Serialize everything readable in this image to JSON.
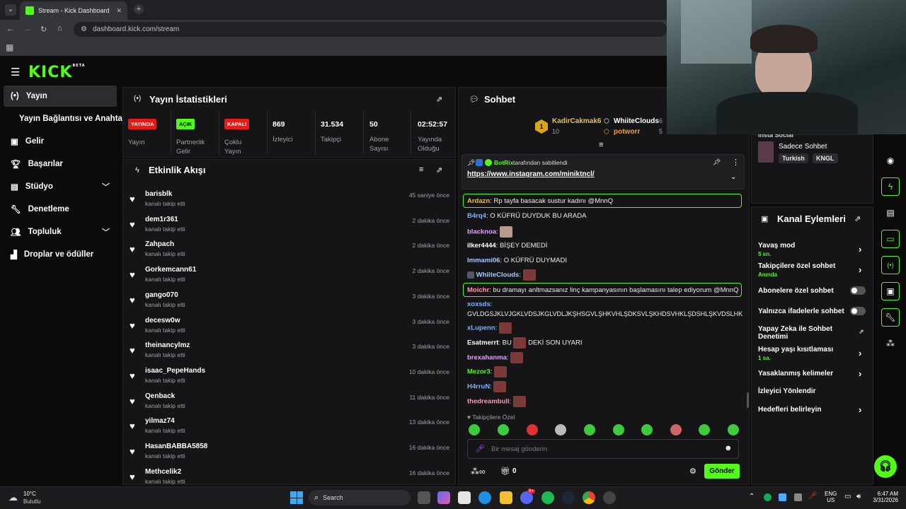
{
  "browser": {
    "tab_title": "Stream - Kick Dashboard",
    "url": "dashboard.kick.com/stream"
  },
  "brand": {
    "logo": "KICK",
    "beta": "BETA"
  },
  "sidebar": {
    "items": [
      {
        "label": "Yayın",
        "icon": "broadcast-icon"
      },
      {
        "label": "Yayın Bağlantısı ve Anahtarı",
        "icon": ""
      },
      {
        "label": "Gelir",
        "icon": "wallet-icon"
      },
      {
        "label": "Başarılar",
        "icon": "trophy-icon"
      },
      {
        "label": "Stüdyo",
        "icon": "studio-icon"
      },
      {
        "label": "Denetleme",
        "icon": "wrench-icon"
      },
      {
        "label": "Topluluk",
        "icon": "users-icon"
      },
      {
        "label": "Droplar ve ödüller",
        "icon": "chart-icon"
      }
    ]
  },
  "stats": {
    "title": "Yayın İstatistikleri",
    "live_badge": "YAYINDA",
    "live_label": "Yayın",
    "partner_badge": "AÇIK",
    "partner_label1": "Partnerlik",
    "partner_label2": "Gelir",
    "multi_badge": "KAPALI",
    "multi_label1": "Çoklu",
    "multi_label2": "Yayın",
    "viewers": "869",
    "viewers_label": "İzleyici",
    "followers": "31.534",
    "followers_label": "Takipçi",
    "subs": "50",
    "subs_label1": "Abone",
    "subs_label2": "Sayısı",
    "uptime": "02:52:57",
    "uptime_label1": "Yayında",
    "uptime_label2": "Olduğu"
  },
  "activity": {
    "title": "Etkinlik Akışı",
    "items": [
      {
        "name": "barisblk",
        "sub": "kanalı takip etti",
        "time": "45 saniye önce"
      },
      {
        "name": "dem1r361",
        "sub": "kanalı takip etti",
        "time": "2 dakika önce"
      },
      {
        "name": "Zahpach",
        "sub": "kanalı takip etti",
        "time": "2 dakika önce"
      },
      {
        "name": "Gorkemcann61",
        "sub": "kanalı takip etti",
        "time": "2 dakika önce"
      },
      {
        "name": "gango070",
        "sub": "kanalı takip etti",
        "time": "3 dakika önce"
      },
      {
        "name": "decesw0w",
        "sub": "kanalı takip etti",
        "time": "3 dakika önce"
      },
      {
        "name": "theinancylmz",
        "sub": "kanalı takip etti",
        "time": "3 dakika önce"
      },
      {
        "name": "isaac_PepeHands",
        "sub": "kanalı takip etti",
        "time": "10 dakika önce"
      },
      {
        "name": "Qenback",
        "sub": "kanalı takip etti",
        "time": "11 dakika önce"
      },
      {
        "name": "yilmaz74",
        "sub": "kanalı takip etti",
        "time": "13 dakika önce"
      },
      {
        "name": "HasanBABBA5858",
        "sub": "kanalı takip etti",
        "time": "16 dakika önce"
      },
      {
        "name": "Methcelik2",
        "sub": "kanalı takip etti",
        "time": "16 dakika önce"
      }
    ]
  },
  "chat": {
    "title": "Sohbet",
    "top": {
      "rank": "1",
      "user1": "KadirCakmak6",
      "user1_count": "10",
      "user2": "WhiiteClouds",
      "user2_count": "6",
      "user3": "potworr",
      "user3_count": "5"
    },
    "pinned": {
      "by": "BotRix",
      "by_suffix": "tarafından sabitlendi",
      "link": "https://www.instagram.com/miniktncl/"
    },
    "messages": [
      {
        "user": "Ardazn",
        "color": "#e6c24a",
        "text": "Rp tayfa basacak sustur kadını @MnnQ"
      },
      {
        "user": "B4rq4",
        "color": "#7db4ff",
        "text": "O KÜFRÜ DUYDUK BU ARADA"
      },
      {
        "user": "blacknoa",
        "color": "#e3a3ff",
        "text": ""
      },
      {
        "user": "ilker4444",
        "color": "#ffffff",
        "text": "BİŞEY DEMEDİ"
      },
      {
        "user": "Immami06",
        "color": "#a8c8ff",
        "text": "O KÜFRÜ DUYMADI"
      },
      {
        "user": "WhiiteClouds",
        "color": "#a8c8ff",
        "text": ""
      },
      {
        "user": "Moichr",
        "color": "#ff9ab0",
        "text": "bu dramayı anltmazsanız linç kampanyasının başlamasını talep ediyorum @MnnQ"
      },
      {
        "user": "xoxsds",
        "color": "#7db4ff",
        "text": ""
      },
      {
        "user": "",
        "color": "#ffffff",
        "text": "GVLDGSJKLVJGKLVDSJKGLVDLJKŞHSGVLŞHKVHLŞDKSVLŞKHDSVHKLŞDSHLŞKVDSLHK"
      },
      {
        "user": "xLupenn",
        "color": "#7db4ff",
        "text": ""
      },
      {
        "user": "Esatmerrt",
        "color": "#ffffff",
        "text": "BU",
        "text2": "DEKİ SON UYARI"
      },
      {
        "user": "brexahanma",
        "color": "#e3a3ff",
        "text": ""
      },
      {
        "user": "Mezor3",
        "color": "#53fc18",
        "text": ""
      },
      {
        "user": "H4rruN",
        "color": "#7db4ff",
        "text": ""
      },
      {
        "user": "thedreambuli",
        "color": "#ff9ab0",
        "text": ""
      }
    ],
    "followers_only": "Takipçilere Özel",
    "input_placeholder": "Bir mesaj gönderin",
    "points": "0",
    "send": "Gönder"
  },
  "right": {
    "partial_label": "Insta Social",
    "chat_mode": "Sadece Sohbet",
    "tags": [
      "Turkish",
      "KNGL"
    ],
    "actions_title": "Kanal Eylemleri",
    "actions": [
      {
        "label": "Yavaş mod",
        "sub": "5 sn.",
        "type": "arrow"
      },
      {
        "label": "Takipçilere özel sohbet",
        "sub": "Anında",
        "type": "arrow"
      },
      {
        "label": "Abonelere özel sohbet",
        "sub": "",
        "type": "toggle"
      },
      {
        "label": "Yalnızca ifadelerle sohbet",
        "sub": "",
        "type": "toggle"
      },
      {
        "label": "Yapay Zeka ile Sohbet Denetimi",
        "sub": "",
        "type": "external"
      },
      {
        "label": "Hesap yaşı kısıtlaması",
        "sub": "1 sa.",
        "type": "arrow"
      },
      {
        "label": "Yasaklanmış kelimeler",
        "sub": "",
        "type": "arrow"
      },
      {
        "label": "İzleyici Yönlendir",
        "sub": "",
        "type": "none"
      },
      {
        "label": "Hedefleri belirleyin",
        "sub": "",
        "type": "arrow"
      }
    ]
  },
  "taskbar": {
    "weather_temp": "10°C",
    "weather_desc": "Bulutlu",
    "search": "Search",
    "lang1": "ENG",
    "lang2": "US",
    "time": "6:47 AM",
    "date": "3/31/2026",
    "discord_badge": "9+"
  },
  "colors": {
    "accent": "#53fc18",
    "live_red": "#e91916",
    "panel": "#151517"
  }
}
